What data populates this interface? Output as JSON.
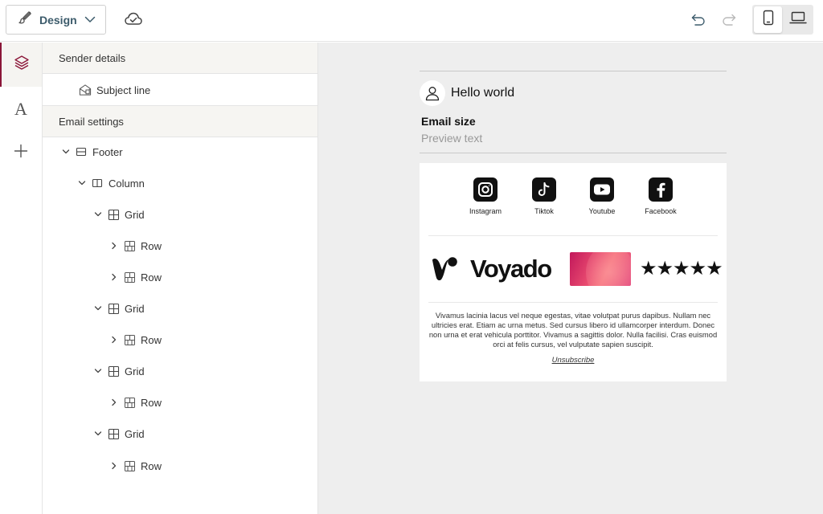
{
  "toolbar": {
    "mode_label": "Design",
    "icons": [
      "brush-icon",
      "chevron-down-icon",
      "cloud-check-icon",
      "undo-icon",
      "redo-icon",
      "mobile-icon",
      "laptop-icon"
    ]
  },
  "rail": {
    "items": [
      {
        "name": "layers",
        "active": true
      },
      {
        "name": "typography",
        "glyph": "A"
      },
      {
        "name": "add",
        "glyph": "+"
      }
    ],
    "accent": "#8a1538"
  },
  "tree": {
    "sender_details": "Sender details",
    "subject_line": "Subject line",
    "email_settings": "Email settings",
    "nodes": [
      {
        "label": "Footer"
      },
      {
        "label": "Column"
      },
      {
        "label": "Grid"
      },
      {
        "label": "Row"
      },
      {
        "label": "Row"
      },
      {
        "label": "Grid"
      },
      {
        "label": "Row"
      },
      {
        "label": "Grid"
      },
      {
        "label": "Row"
      },
      {
        "label": "Grid"
      },
      {
        "label": "Row"
      }
    ]
  },
  "preview": {
    "sender_name": "Hello world",
    "email_size": "Email size",
    "preview_text": "Preview text",
    "socials": [
      {
        "label": "Instagram"
      },
      {
        "label": "Tiktok"
      },
      {
        "label": "Youtube"
      },
      {
        "label": "Facebook"
      }
    ],
    "brand_name": "Voyado",
    "stars": "★★★★★",
    "body_text": "Vivamus lacinia lacus vel neque egestas, vitae volutpat purus dapibus. Nullam nec ultricies erat. Etiam ac urna metus. Sed cursus libero id ullamcorper interdum. Donec non urna et erat vehicula porttitor. Vivamus a sagittis dolor. Nulla facilisi. Cras euismod orci at felis cursus, vel vulputate sapien suscipit.",
    "unsubscribe": "Unsubscribe"
  }
}
